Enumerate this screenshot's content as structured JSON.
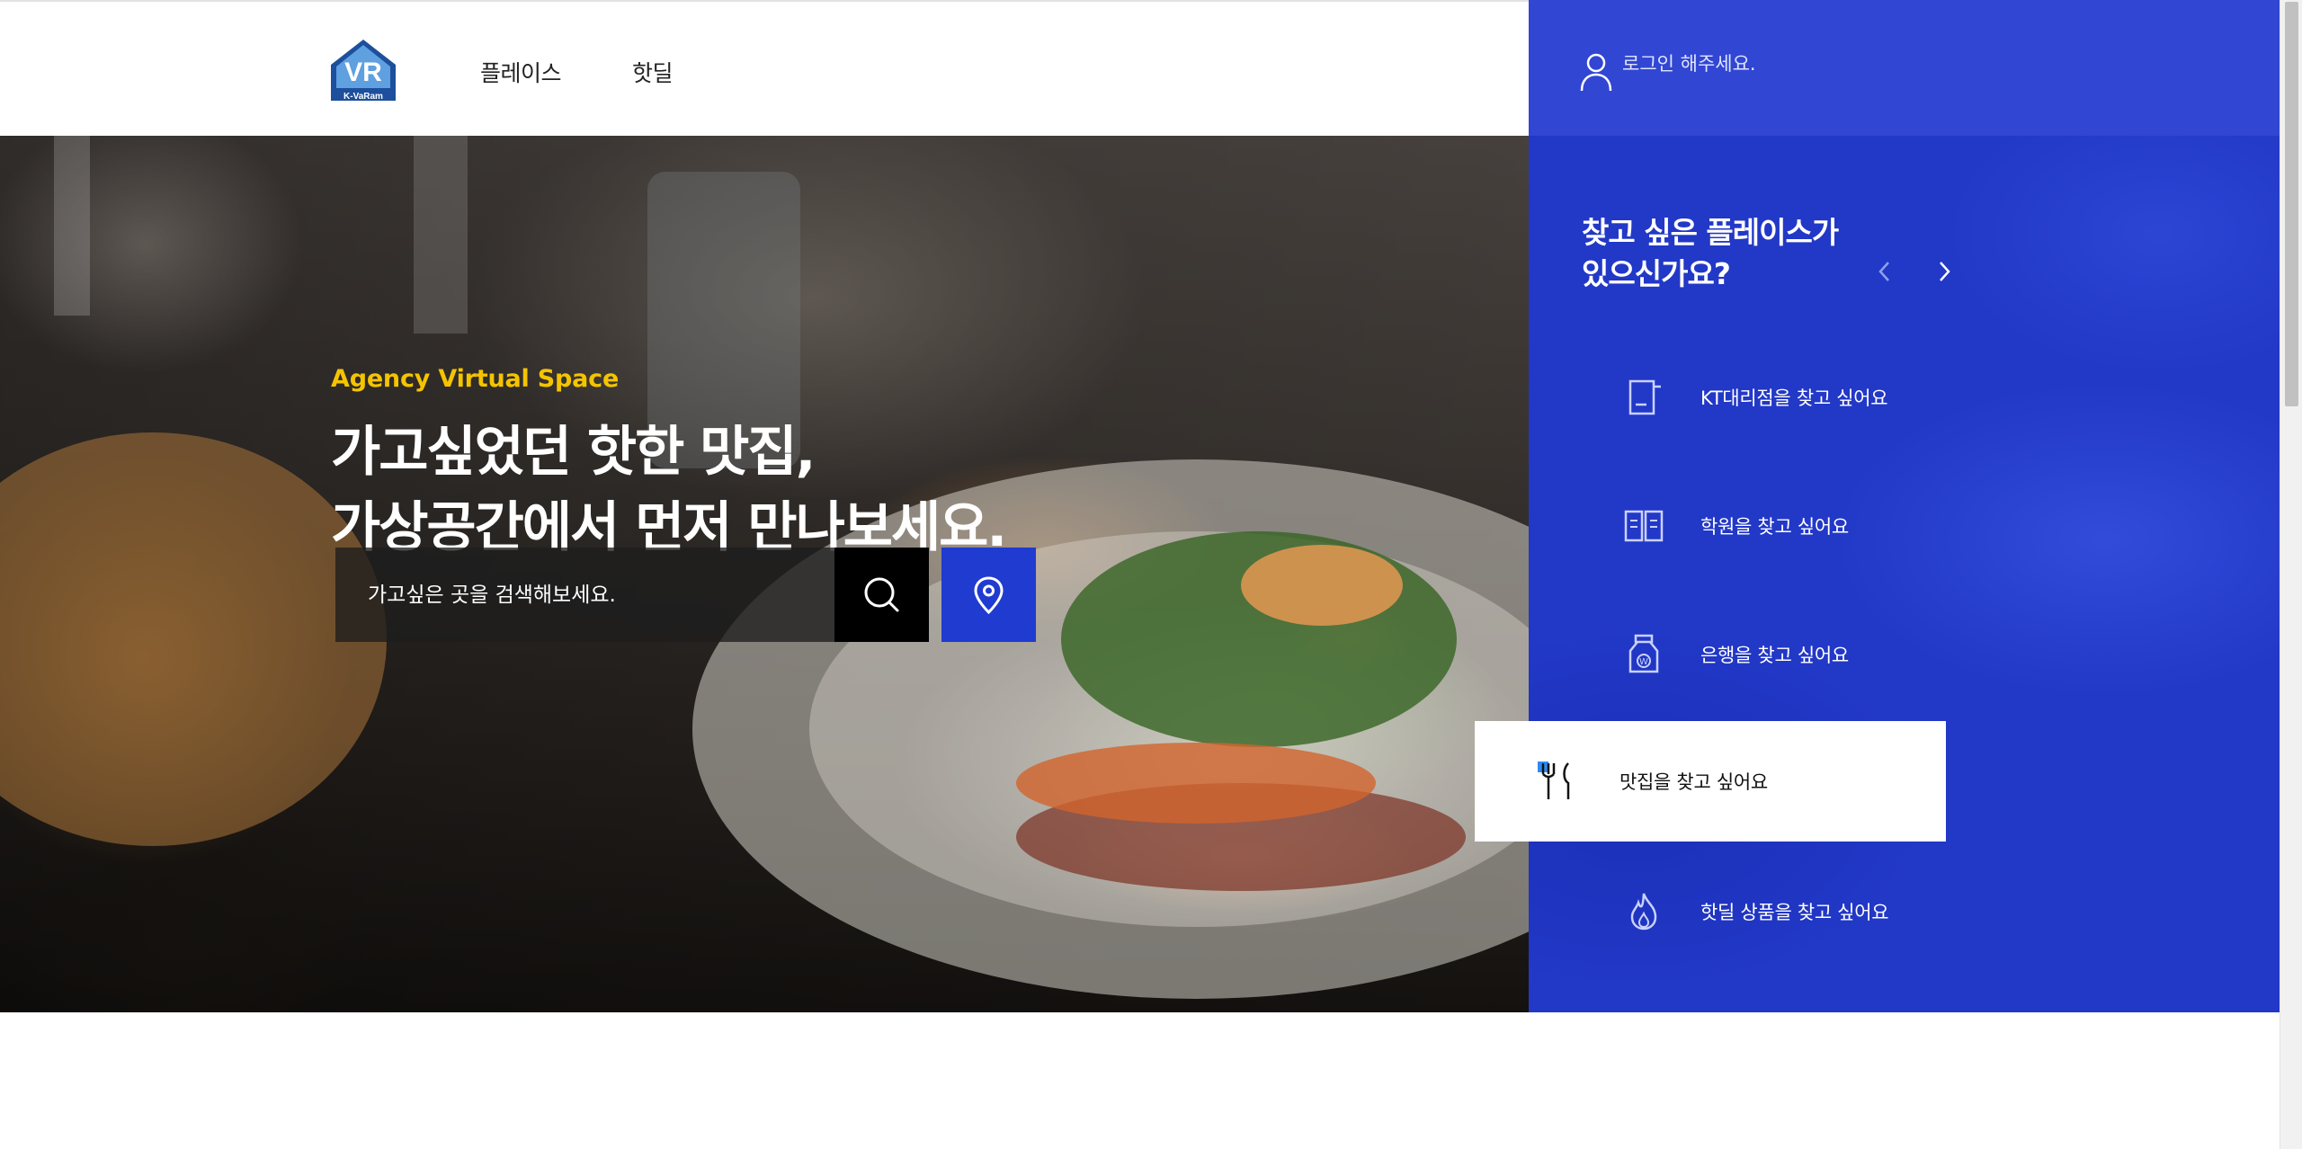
{
  "header": {
    "logo_text": "K-VaRam",
    "logo_letters": "VR",
    "nav": [
      {
        "label": "플레이스"
      },
      {
        "label": "핫딜"
      }
    ]
  },
  "hero": {
    "subtitle": "Agency Virtual Space",
    "title_lines": [
      "가고싶었던 핫한 맛집,",
      "가상공간에서 먼저 만나보세요."
    ],
    "search": {
      "placeholder": "가고싶은 곳을 검색해보세요."
    },
    "search_icon": "search-icon",
    "location_icon": "location-pin-icon"
  },
  "panel": {
    "login_text": "로그인 해주세요.",
    "user_icon": "user-icon",
    "heading_lines": [
      "찾고 싶은 플레이스가",
      "있으신가요?"
    ],
    "categories": [
      {
        "label": "KT대리점을 찾고 싶어요",
        "icon": "store-icon"
      },
      {
        "label": "학원을 찾고 싶어요",
        "icon": "book-icon"
      },
      {
        "label": "은행을 찾고 싶어요",
        "icon": "bank-icon"
      },
      {
        "label": "맛집을 찾고 싶어요",
        "icon": "fork-knife-icon",
        "active": true
      },
      {
        "label": "핫딜 상품을 찾고 싶어요",
        "icon": "fire-icon"
      }
    ]
  },
  "colors": {
    "brand_blue": "#2238c7",
    "accent_yellow": "#f5c400",
    "location_button": "#1f3bd0"
  }
}
